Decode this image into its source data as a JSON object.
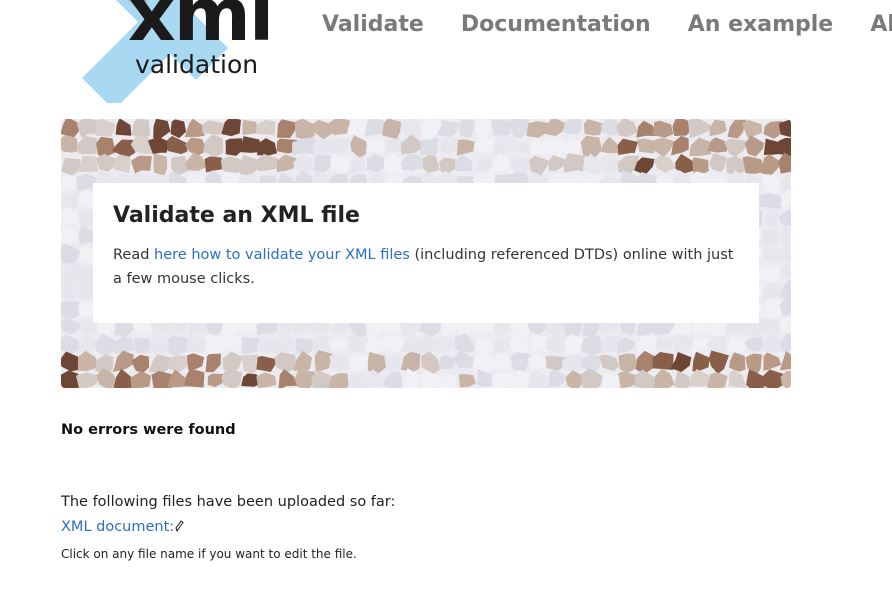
{
  "logo": {
    "word": "xml",
    "subtitle": "validation",
    "x_color": "#a9d9f2"
  },
  "nav": {
    "items": [
      "Validate",
      "Documentation",
      "An example",
      "About"
    ]
  },
  "hero": {
    "title": "Validate an XML file",
    "text_before": "Read ",
    "link_text": "here how to validate your XML files",
    "text_after": " (including referenced DTDs) online with just a few mouse clicks."
  },
  "result": {
    "status": "No errors were found",
    "uploaded_label": "The following files have been uploaded so far:",
    "file_link": "XML document:",
    "hint": "Click on any file name if you want to edit the file."
  },
  "colors": {
    "link": "#2a6fcb",
    "nav": "#7a7a7a",
    "text": "#222222"
  },
  "icons": {
    "edit": "pencil-icon"
  }
}
